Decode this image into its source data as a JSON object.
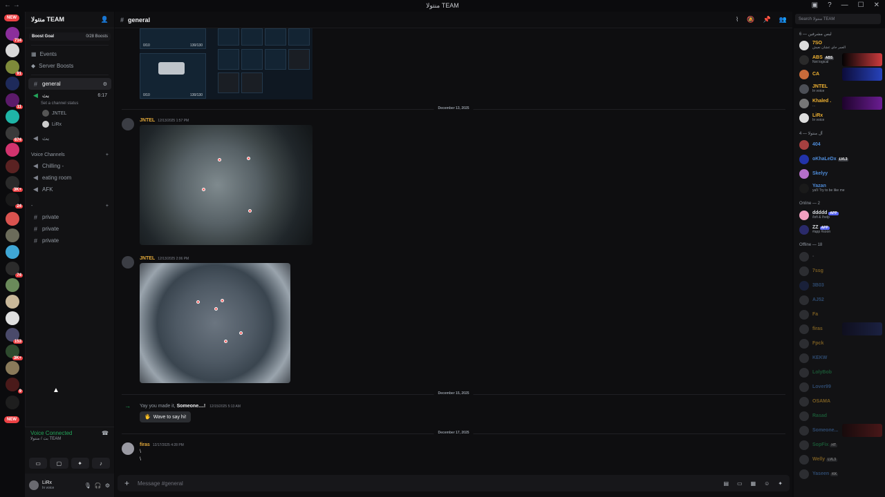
{
  "window": {
    "title": "منتولا TEAM"
  },
  "server": {
    "name": "منتولا TEAM",
    "boost_goal_label": "Boost Goal",
    "boost_progress": "0/28 Boosts"
  },
  "rail": {
    "new_label": "NEW",
    "new_label_bottom": "NEW",
    "badges": [
      "714",
      "91",
      "11",
      "674",
      "3K+",
      "24",
      "74",
      "153",
      "3K+",
      "9"
    ]
  },
  "nav": {
    "events": "Events",
    "server_boosts": "Server Boosts"
  },
  "channels": {
    "general": "general",
    "voice_active": {
      "name": "بث",
      "time": "6:17",
      "status": "Set a channel status",
      "users": [
        "JNTEL",
        "LiRx"
      ]
    },
    "voice2": "بث",
    "category_voice": "Voice Channels",
    "voice_list": [
      "Chilling -",
      "eating room",
      "AFK"
    ],
    "category_misc": "-",
    "private_list": [
      "private",
      "private",
      "private"
    ]
  },
  "voice_panel": {
    "status": "Voice Connected",
    "sub": "بث / منتولا TEAM"
  },
  "user_bar": {
    "name": "LiRx",
    "status": "In voice"
  },
  "main": {
    "channel_title": "general",
    "search_placeholder": "Search منتولا TEAM",
    "composer_placeholder": "Message #general"
  },
  "inventory": {
    "slot_a_count": "0/10",
    "slot_a_ammo": "130/130",
    "slot_b_count": "0/10",
    "slot_b_ammo": "130/130"
  },
  "messages": {
    "day1": "December 13, 2025",
    "m1_author": "JNTEL",
    "m1_time": "12/13/2025 1:57 PM",
    "m2_author": "JNTEL",
    "m2_time": "12/13/2025 2:06 PM",
    "day2": "December 15, 2025",
    "sys_prefix": "Yay you made it,",
    "sys_user": "Someone....!",
    "sys_time": "12/15/2025 5:13 AM",
    "wave_label": "Wave to say hi!",
    "day3": "December 17, 2025",
    "m3_author": "firas",
    "m3_time": "12/17/2025 4:28 PM",
    "m3_line1": "\\",
    "m3_line2": "\\"
  },
  "members": {
    "group1_header": "ليس مشرفين — 6",
    "group1": [
      {
        "name": "7SO",
        "status": "العمر جاي عشان نعيش",
        "color": "#f0b232"
      },
      {
        "name": "ABS",
        "tag": "ABS",
        "status": "Not logical",
        "color": "#f0b232"
      },
      {
        "name": "CA",
        "color": "#f0b232"
      },
      {
        "name": "JNTEL",
        "status": "In voice",
        "color": "#f0b232"
      },
      {
        "name": "Khaled .",
        "status": "...",
        "color": "#f0b232"
      },
      {
        "name": "LiRx",
        "status": "In voice",
        "color": "#f0b232"
      }
    ],
    "group2_header": "أل منتولا — 4",
    "group2": [
      {
        "name": "404",
        "color": "#4e8bd8"
      },
      {
        "name": "oKhaLeDx",
        "tag": "LVL3",
        "color": "#4e8bd8"
      },
      {
        "name": "Skelyy",
        "color": "#4e8bd8"
      },
      {
        "name": "Yazan",
        "status": "ya'll Try to be like me",
        "color": "#4e8bd8"
      }
    ],
    "online_header": "Online — 2",
    "online": [
      {
        "name": "ddddd",
        "tag": "APP",
        "status": "/lofi & /help",
        "color": "#dbdee1"
      },
      {
        "name": "ZZ",
        "tag": "APP",
        "status": "#app #soon",
        "color": "#dbdee1"
      }
    ],
    "offline_header": "Offline — 18",
    "offline": [
      {
        "name": "-",
        "color": "#949ba4"
      },
      {
        "name": "7ssg",
        "color": "#f0b232"
      },
      {
        "name": "3B03",
        "color": "#4e8bd8"
      },
      {
        "name": "AJ52",
        "color": "#4e8bd8"
      },
      {
        "name": "Fa",
        "color": "#f0b232"
      },
      {
        "name": "firas",
        "color": "#f0b232"
      },
      {
        "name": "Fpck",
        "color": "#f0b232"
      },
      {
        "name": "KEKW",
        "color": "#4e8bd8"
      },
      {
        "name": "LolyBob",
        "color": "#23a55a"
      },
      {
        "name": "Lover99",
        "color": "#4e8bd8"
      },
      {
        "name": "OSAMA",
        "color": "#f0b232"
      },
      {
        "name": "Rasad",
        "color": "#23a55a"
      },
      {
        "name": "Someone...",
        "color": "#4e8bd8"
      },
      {
        "name": "SopFix",
        "tag": "HT",
        "color": "#23a55a"
      },
      {
        "name": "Welly",
        "tag": "LVL3",
        "color": "#f0b232"
      },
      {
        "name": "Yaseen",
        "tag": "KK",
        "color": "#4e8bd8"
      }
    ]
  },
  "colors": {
    "accent_gold": "#e3a93a",
    "voice_green": "#23a55a",
    "danger": "#ed4245",
    "blurple": "#5865f2"
  }
}
